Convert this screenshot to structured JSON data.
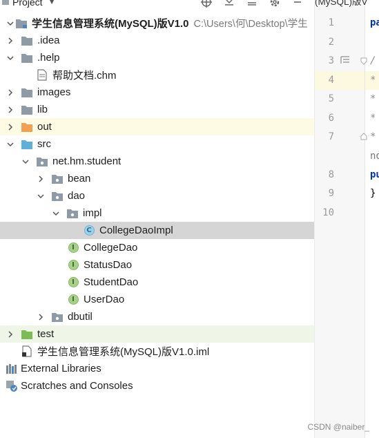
{
  "panel": {
    "title": "Project"
  },
  "tree": {
    "root": {
      "label": "学生信息管理系统(MySQL)版V1.0",
      "path": "C:\\Users\\何\\Desktop\\学生"
    },
    "idea": ".idea",
    "help": ".help",
    "help_file": "帮助文档.chm",
    "images": "images",
    "lib": "lib",
    "out": "out",
    "src": "src",
    "package": "net.hm.student",
    "bean": "bean",
    "dao": "dao",
    "impl": "impl",
    "college_dao_impl": "CollegeDaoImpl",
    "college_dao": "CollegeDao",
    "status_dao": "StatusDao",
    "student_dao": "StudentDao",
    "user_dao": "UserDao",
    "dbutil": "dbutil",
    "test": "test",
    "iml_file": "学生信息管理系统(MySQL)版V1.0.iml",
    "external_libraries": "External Libraries",
    "scratches": "Scratches and Consoles"
  },
  "editor": {
    "tab_title": "(MySQL)版V",
    "line_numbers": [
      "1",
      "2",
      "3",
      "4",
      "5",
      "6",
      "7",
      "8",
      "9",
      "10"
    ],
    "code": {
      "line1": "pa",
      "line3": "/",
      "line4": "*",
      "line5": "*",
      "line6": "*",
      "line7": "*",
      "line_no": "no",
      "line8": "pu",
      "line9": "}"
    }
  },
  "watermark": "CSDN @naiber_",
  "colors": {
    "folder": "#8e9aa6",
    "folder_out": "#f0a154",
    "folder_src": "#5fb0d8",
    "folder_test": "#7dbb54",
    "selected_bg": "#d5d5d5",
    "excluded_bg": "#fdfbe3",
    "test_bg": "#eff6e8"
  }
}
